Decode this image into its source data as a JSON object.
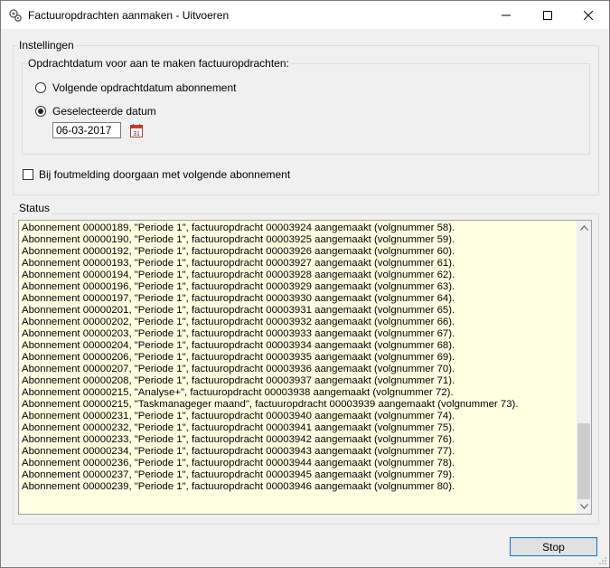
{
  "window": {
    "title": "Factuuropdrachten aanmaken - Uitvoeren",
    "minimize_icon": "minimize-icon",
    "maximize_icon": "maximize-icon",
    "close_icon": "close-icon"
  },
  "settings": {
    "group_label": "Instellingen",
    "date_group_label": "Opdrachtdatum voor aan te maken factuuropdrachten:",
    "radio_next_label": "Volgende opdrachtdatum abonnement",
    "radio_selected_label": "Geselecteerde datum",
    "selected_option": "Geselecteerde datum",
    "date_value": "06-03-2017",
    "calendar_icon": "calendar-icon",
    "checkbox_label": "Bij foutmelding doorgaan met volgende abonnement",
    "checkbox_checked": false
  },
  "status": {
    "group_label": "Status",
    "lines": [
      "Abonnement 00000189, \"Periode 1\", factuuropdracht 00003924 aangemaakt (volgnummer 58).",
      "Abonnement 00000190, \"Periode 1\", factuuropdracht 00003925 aangemaakt (volgnummer 59).",
      "Abonnement 00000192, \"Periode 1\", factuuropdracht 00003926 aangemaakt (volgnummer 60).",
      "Abonnement 00000193, \"Periode 1\", factuuropdracht 00003927 aangemaakt (volgnummer 61).",
      "Abonnement 00000194, \"Periode 1\", factuuropdracht 00003928 aangemaakt (volgnummer 62).",
      "Abonnement 00000196, \"Periode 1\", factuuropdracht 00003929 aangemaakt (volgnummer 63).",
      "Abonnement 00000197, \"Periode 1\", factuuropdracht 00003930 aangemaakt (volgnummer 64).",
      "Abonnement 00000201, \"Periode 1\", factuuropdracht 00003931 aangemaakt (volgnummer 65).",
      "Abonnement 00000202, \"Periode 1\", factuuropdracht 00003932 aangemaakt (volgnummer 66).",
      "Abonnement 00000203, \"Periode 1\", factuuropdracht 00003933 aangemaakt (volgnummer 67).",
      "Abonnement 00000204, \"Periode 1\", factuuropdracht 00003934 aangemaakt (volgnummer 68).",
      "Abonnement 00000206, \"Periode 1\", factuuropdracht 00003935 aangemaakt (volgnummer 69).",
      "Abonnement 00000207, \"Periode 1\", factuuropdracht 00003936 aangemaakt (volgnummer 70).",
      "Abonnement 00000208, \"Periode 1\", factuuropdracht 00003937 aangemaakt (volgnummer 71).",
      "Abonnement 00000215, \"Analyse+\", factuuropdracht 00003938 aangemaakt (volgnummer 72).",
      "Abonnement 00000215, \"Taskmanageger maand\", factuuropdracht 00003939 aangemaakt (volgnummer 73).",
      "Abonnement 00000231, \"Periode 1\", factuuropdracht 00003940 aangemaakt (volgnummer 74).",
      "Abonnement 00000232, \"Periode 1\", factuuropdracht 00003941 aangemaakt (volgnummer 75).",
      "Abonnement 00000233, \"Periode 1\", factuuropdracht 00003942 aangemaakt (volgnummer 76).",
      "Abonnement 00000234, \"Periode 1\", factuuropdracht 00003943 aangemaakt (volgnummer 77).",
      "Abonnement 00000236, \"Periode 1\", factuuropdracht 00003944 aangemaakt (volgnummer 78).",
      "Abonnement 00000237, \"Periode 1\", factuuropdracht 00003945 aangemaakt (volgnummer 79).",
      "Abonnement 00000239, \"Periode 1\", factuuropdracht 00003946 aangemaakt (volgnummer 80)."
    ]
  },
  "footer": {
    "stop_label": "Stop"
  },
  "colors": {
    "log_background": "#ffffe1",
    "button_focus_border": "#0078d7",
    "window_background": "#f0f0f0"
  }
}
